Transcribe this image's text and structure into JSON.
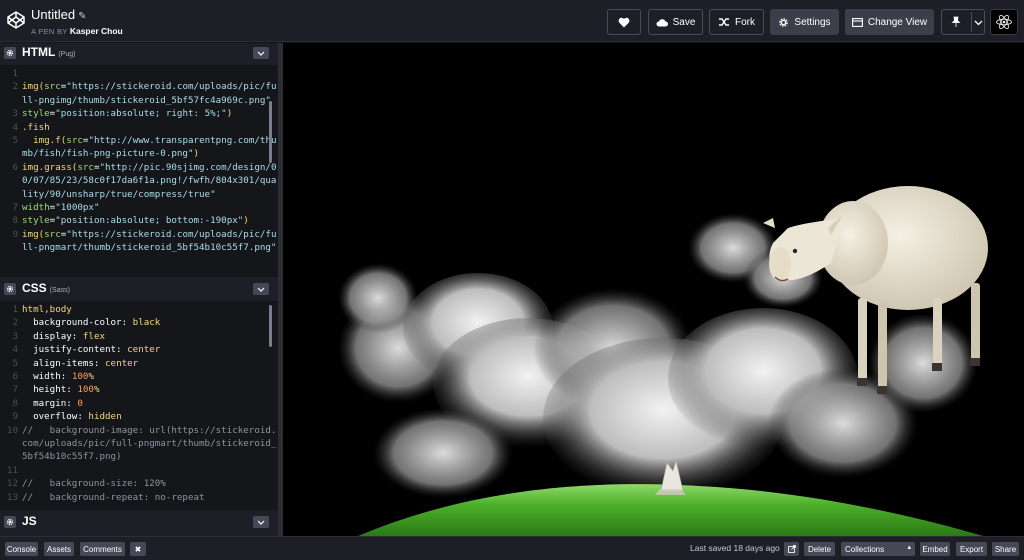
{
  "app": {
    "title": "Untitled",
    "byline_prefix": "A PEN BY",
    "author": "Kasper Chou"
  },
  "header_buttons": {
    "save": "Save",
    "fork": "Fork",
    "settings": "Settings",
    "change_view": "Change View"
  },
  "panes": {
    "html": {
      "name": "HTML",
      "preprocessor": "(Pug)"
    },
    "css": {
      "name": "CSS",
      "preprocessor": "(Sass)"
    },
    "js": {
      "name": "JS"
    }
  },
  "html_code": [
    {
      "n": "1",
      "parts": []
    },
    {
      "n": "2",
      "parts": [
        [
          "c-yel",
          "img("
        ],
        [
          "c-grn",
          "src"
        ],
        [
          "c-wht",
          "="
        ],
        [
          "c-str",
          "\"https://stickeroid.com/uploads/pic/full-pngimg/thumb/stickeroid_5bf57fc4a969c.png\""
        ]
      ]
    },
    {
      "n": "3",
      "parts": [
        [
          "c-grn",
          "style"
        ],
        [
          "c-wht",
          "="
        ],
        [
          "c-str",
          "\"position:absolute; right: 5%;\""
        ],
        [
          "c-yel",
          ")"
        ]
      ]
    },
    {
      "n": "4",
      "parts": [
        [
          "c-yel",
          ".fish"
        ]
      ]
    },
    {
      "n": "5",
      "parts": [
        [
          "c-wht",
          "  "
        ],
        [
          "c-yel",
          "img.f("
        ],
        [
          "c-grn",
          "src"
        ],
        [
          "c-wht",
          "="
        ],
        [
          "c-str",
          "\"http://www.transparentpng.com/thumb/fish/fish-png-picture-0.png\""
        ],
        [
          "c-yel",
          ")"
        ]
      ]
    },
    {
      "n": "6",
      "parts": [
        [
          "c-yel",
          "img.grass("
        ],
        [
          "c-grn",
          "src"
        ],
        [
          "c-wht",
          "="
        ],
        [
          "c-str",
          "\"http://pic.90sjimg.com/design/00/07/85/23/58c0f17da6f1a.png!/fwfh/804x301/quality/90/unsharp/true/compress/true\""
        ]
      ]
    },
    {
      "n": "7",
      "parts": [
        [
          "c-grn",
          "width"
        ],
        [
          "c-wht",
          "="
        ],
        [
          "c-str",
          "\"1000px\""
        ]
      ]
    },
    {
      "n": "8",
      "parts": [
        [
          "c-grn",
          "style"
        ],
        [
          "c-wht",
          "="
        ],
        [
          "c-str",
          "\"position:absolute; bottom:-190px\""
        ],
        [
          "c-yel",
          ")"
        ]
      ]
    },
    {
      "n": "9",
      "parts": [
        [
          "c-yel",
          "img("
        ],
        [
          "c-grn",
          "src"
        ],
        [
          "c-wht",
          "="
        ],
        [
          "c-str",
          "\"https://stickeroid.com/uploads/pic/full-pngmart/thumb/stickeroid_5bf54b10c55f7.png\""
        ]
      ]
    }
  ],
  "css_code": [
    {
      "n": "1",
      "parts": [
        [
          "c-yel",
          "html,body"
        ]
      ]
    },
    {
      "n": "2",
      "parts": [
        [
          "c-wht",
          "  background-color: "
        ],
        [
          "c-yel",
          "black"
        ]
      ]
    },
    {
      "n": "3",
      "parts": [
        [
          "c-wht",
          "  display: "
        ],
        [
          "c-yel",
          "flex"
        ]
      ]
    },
    {
      "n": "4",
      "parts": [
        [
          "c-wht",
          "  justify-content: "
        ],
        [
          "c-yel",
          "center"
        ]
      ]
    },
    {
      "n": "5",
      "parts": [
        [
          "c-wht",
          "  align-items: "
        ],
        [
          "c-yel",
          "center"
        ]
      ]
    },
    {
      "n": "6",
      "parts": [
        [
          "c-wht",
          "  width: "
        ],
        [
          "c-org",
          "100"
        ],
        [
          "c-yel",
          "%"
        ]
      ]
    },
    {
      "n": "7",
      "parts": [
        [
          "c-wht",
          "  height: "
        ],
        [
          "c-org",
          "100"
        ],
        [
          "c-yel",
          "%"
        ]
      ]
    },
    {
      "n": "8",
      "parts": [
        [
          "c-wht",
          "  margin: "
        ],
        [
          "c-org",
          "0"
        ]
      ]
    },
    {
      "n": "9",
      "parts": [
        [
          "c-wht",
          "  overflow: "
        ],
        [
          "c-yel",
          "hidden"
        ]
      ]
    },
    {
      "n": "10",
      "parts": [
        [
          "c-cmt",
          "//   background-image: url(https://stickeroid.com/uploads/pic/full-pngmart/thumb/stickeroid_5bf54b10c55f7.png)"
        ]
      ]
    },
    {
      "n": "11",
      "parts": []
    },
    {
      "n": "12",
      "parts": [
        [
          "c-cmt",
          "//   background-size: 120%"
        ]
      ]
    },
    {
      "n": "13",
      "parts": [
        [
          "c-cmt",
          "//   background-repeat: no-repeat"
        ]
      ]
    }
  ],
  "footer": {
    "console": "Console",
    "assets": "Assets",
    "comments": "Comments",
    "close_glyph": "✖",
    "last_saved": "Last saved 18 days ago",
    "delete": "Delete",
    "collections": "Collections",
    "embed": "Embed",
    "export": "Export",
    "share": "Share"
  },
  "colors": {
    "header_bg": "#1e1f26",
    "editor_bg": "#151619",
    "grass": "#4caf2a",
    "preview_bg": "#000000"
  }
}
